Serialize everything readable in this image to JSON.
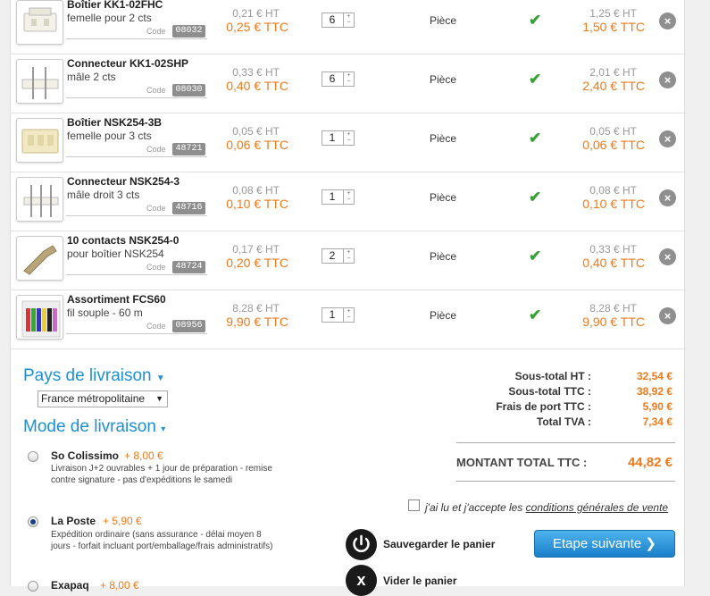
{
  "products": [
    {
      "name": "Boîtier KK1-02FHC",
      "desc": "femelle pour 2 cts",
      "code_label": "Code",
      "code": "08032",
      "price_ht": "0,21 € HT",
      "price_ttc": "0,25 € TTC",
      "qty": "6",
      "unit": "Pièce",
      "total_ht": "1,25 € HT",
      "total_ttc": "1,50 € TTC"
    },
    {
      "name": "Connecteur KK1-02SHP",
      "desc": "mâle 2 cts",
      "code_label": "Code",
      "code": "08030",
      "price_ht": "0,33 € HT",
      "price_ttc": "0,40 € TTC",
      "qty": "6",
      "unit": "Pièce",
      "total_ht": "2,01 € HT",
      "total_ttc": "2,40 € TTC"
    },
    {
      "name": "Boîtier NSK254-3B",
      "desc": "femelle pour 3 cts",
      "code_label": "Code",
      "code": "48721",
      "price_ht": "0,05 € HT",
      "price_ttc": "0,06 € TTC",
      "qty": "1",
      "unit": "Pièce",
      "total_ht": "0,05 € HT",
      "total_ttc": "0,06 € TTC"
    },
    {
      "name": "Connecteur NSK254-3",
      "desc": "mâle droit 3 cts",
      "code_label": "Code",
      "code": "48716",
      "price_ht": "0,08 € HT",
      "price_ttc": "0,10 € TTC",
      "qty": "1",
      "unit": "Pièce",
      "total_ht": "0,08 € HT",
      "total_ttc": "0,10 € TTC"
    },
    {
      "name": "10 contacts NSK254-0",
      "desc": "pour boîtier NSK254",
      "code_label": "Code",
      "code": "48724",
      "price_ht": "0,17 € HT",
      "price_ttc": "0,20 € TTC",
      "qty": "2",
      "unit": "Pièce",
      "total_ht": "0,33 € HT",
      "total_ttc": "0,40 € TTC"
    },
    {
      "name": "Assortiment FCS60",
      "desc": "fil souple - 60 m",
      "code_label": "Code",
      "code": "08956",
      "price_ht": "8,28 € HT",
      "price_ttc": "9,90 € TTC",
      "qty": "1",
      "unit": "Pièce",
      "total_ht": "8,28 € HT",
      "total_ttc": "9,90 € TTC"
    }
  ],
  "delivery": {
    "country_title": "Pays de livraison",
    "country_value": "France métropolitaine",
    "mode_title": "Mode de livraison",
    "options": [
      {
        "name": "So Colissimo",
        "price": "+ 8,00 €",
        "desc": "Livraison J+2 ouvrables + 1 jour de préparation - remise contre signature - pas d'expéditions le samedi",
        "selected": false
      },
      {
        "name": "La Poste",
        "price": "+ 5,90 €",
        "desc": "Expédition ordinaire (sans assurance - délai moyen 8 jours - forfait incluant port/emballage/frais administratifs)",
        "selected": true
      },
      {
        "name": "Exapaq",
        "price": "+ 8,00 €",
        "desc": "",
        "selected": false
      }
    ]
  },
  "totals": {
    "subtotal_ht_label": "Sous-total HT :",
    "subtotal_ht": "32,54 €",
    "subtotal_ttc_label": "Sous-total TTC :",
    "subtotal_ttc": "38,92 €",
    "shipping_label": "Frais de port TTC :",
    "shipping": "5,90 €",
    "tva_label": "Total TVA :",
    "tva": "7,34 €",
    "grand_label": "MONTANT TOTAL TTC :",
    "grand": "44,82 €"
  },
  "cgv": {
    "prefix": "j'ai lu et j'accepte les ",
    "link": "conditions générales de vente"
  },
  "actions": {
    "save": "Sauvegarder le panier",
    "empty": "Vider le panier",
    "next": "Etape suivante ❯"
  },
  "colors": {
    "accent_orange": "#ee7a1c",
    "accent_blue": "#1e90d2",
    "check_green": "#3aa13a"
  }
}
